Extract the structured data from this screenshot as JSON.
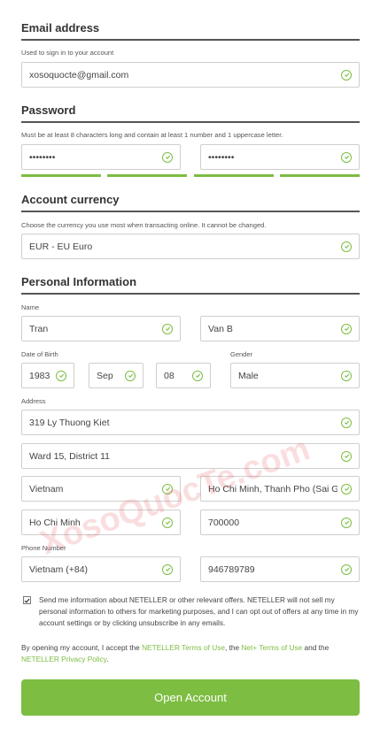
{
  "email": {
    "title": "Email address",
    "hint": "Used to sign in to your account",
    "value": "xosoquocte@gmail.com"
  },
  "password": {
    "title": "Password",
    "hint": "Must be at least 8 characters long and contain at least 1 number and 1 uppercase letter.",
    "value1": "••••••••",
    "value2": "••••••••",
    "strength_bars": 4
  },
  "currency": {
    "title": "Account currency",
    "hint": "Choose the currency you use most when transacting online. It cannot be changed.",
    "value": "EUR - EU Euro"
  },
  "personal": {
    "title": "Personal Information",
    "name_label": "Name",
    "first_name": "Tran",
    "last_name": "Van B",
    "dob_label": "Date of Birth",
    "dob_year": "1983",
    "dob_month": "Sep",
    "dob_day": "08",
    "gender_label": "Gender",
    "gender": "Male",
    "address_label": "Address",
    "address1": "319 Ly Thuong Kiet",
    "address2": "Ward 15, District 11",
    "country": "Vietnam",
    "city": "Ho Chi Minh, Thanh Pho (Sai Gon)",
    "state": "Ho Chi Minh",
    "postcode": "700000",
    "phone_label": "Phone Number",
    "phone_country": "Vietnam (+84)",
    "phone": "946789789"
  },
  "consent": {
    "text": "Send me information about NETELLER or other relevant offers. NETELLER will not sell my personal information to others for marketing purposes, and I can opt out of offers at any time in my account settings or by clicking unsubscribe in any emails.",
    "checked": true
  },
  "terms": {
    "prefix": "By opening my account, I accept the ",
    "link1": "NETELLER Terms of Use",
    "mid1": ", the ",
    "link2": "Net+ Terms of Use",
    "mid2": " and the ",
    "link3": "NETELLER Privacy Policy",
    "suffix": "."
  },
  "submit_label": "Open Account",
  "watermark": "XosoQuocTe.com",
  "colors": {
    "accent": "#7dbd42",
    "rule": "#555555",
    "text": "#333333"
  }
}
